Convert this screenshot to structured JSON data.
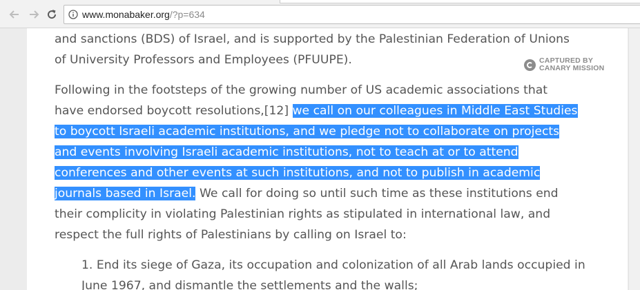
{
  "browser": {
    "back_icon": "back-arrow-icon",
    "forward_icon": "forward-arrow-icon",
    "reload_icon": "reload-icon",
    "info_icon": "info-circle-icon",
    "url_host": "www.monabaker.org",
    "url_path": "/?p=634"
  },
  "watermark": {
    "line1": "CAPTURED BY",
    "line2": "CANARY MISSION",
    "icon": "canary-mission-logo-icon"
  },
  "article": {
    "para1": [
      "and sanctions (BDS) of Israel, and is supported by the Palestinian Federation of Unions",
      "of University Professors and Employees (PFUUPE)."
    ],
    "para2": {
      "line1": "Following in the footsteps of the growing number of US academic associations that",
      "line2_plain": "have endorsed boycott resolutions,[12] ",
      "line2_hl": "we call on our colleagues in Middle East Studies",
      "line3_hl": "to boycott Israeli academic institutions, and we pledge not to collaborate on projects",
      "line4_hl": "and events involving Israeli academic institutions, not to teach at or to attend",
      "line5_hl": "conferences and other events at such institutions, and not to publish in academic",
      "line6_hl": "journals based in Israel.",
      "line6_plain": " We call for doing so until such time as these institutions end",
      "line7": "their complicity in violating Palestinian rights as stipulated in international law, and",
      "line8": "respect the full rights of Palestinians by calling on Israel to:"
    },
    "list": {
      "item1_line1": "1. End its siege of Gaza, its occupation and colonization of all Arab lands occupied in",
      "item1_line2": "June 1967, and dismantle the settlements and the walls;"
    }
  },
  "colors": {
    "selection": "#3390ff",
    "body_text": "#555555",
    "watermark": "#8c8c8c"
  }
}
